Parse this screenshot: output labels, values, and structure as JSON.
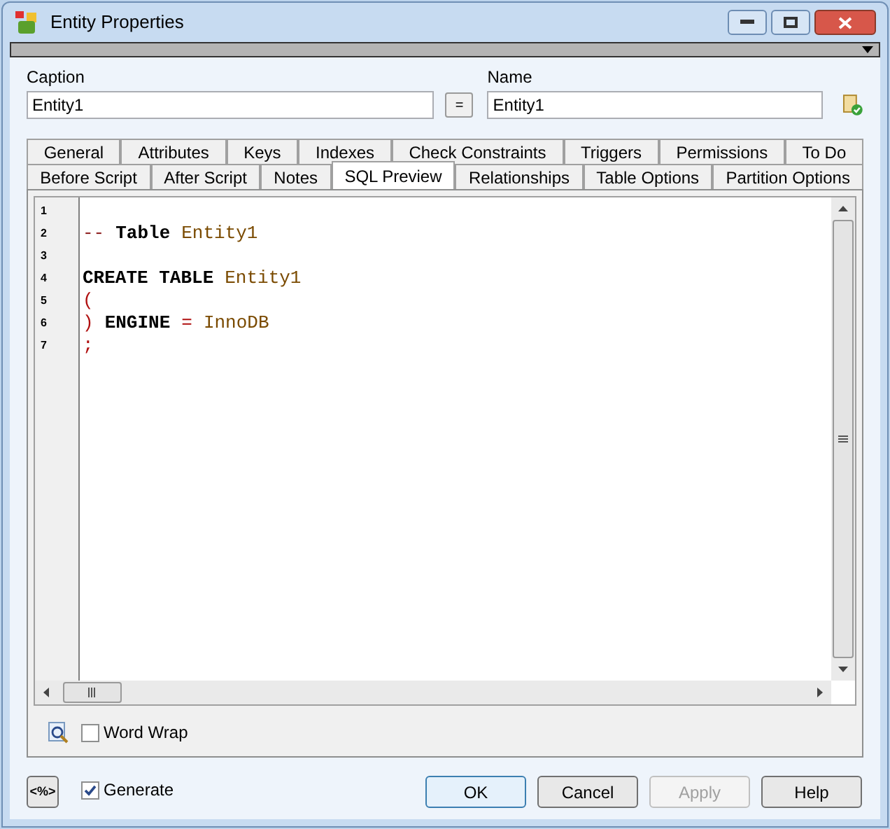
{
  "window": {
    "title": "Entity Properties"
  },
  "caption": {
    "label": "Caption",
    "value": "Entity1"
  },
  "copy_button": "=",
  "name": {
    "label": "Name",
    "value": "Entity1"
  },
  "tab_rows": [
    [
      {
        "label": "General",
        "selected": false
      },
      {
        "label": "Attributes",
        "selected": false
      },
      {
        "label": "Keys",
        "selected": false
      },
      {
        "label": "Indexes",
        "selected": false
      },
      {
        "label": "Check Constraints",
        "selected": false
      },
      {
        "label": "Triggers",
        "selected": false
      },
      {
        "label": "Permissions",
        "selected": false
      },
      {
        "label": "To Do",
        "selected": false
      }
    ],
    [
      {
        "label": "Before Script",
        "selected": false
      },
      {
        "label": "After Script",
        "selected": false
      },
      {
        "label": "Notes",
        "selected": false
      },
      {
        "label": "SQL Preview",
        "selected": true
      },
      {
        "label": "Relationships",
        "selected": false
      },
      {
        "label": "Table Options",
        "selected": false
      },
      {
        "label": "Partition Options",
        "selected": false
      }
    ]
  ],
  "editor": {
    "lines": [
      {
        "number": "1"
      },
      {
        "number": "2",
        "tokens": [
          {
            "kind": "comment",
            "text": "--"
          },
          {
            "kind": "keyword",
            "text": "Table"
          },
          {
            "kind": "ident",
            "text": "Entity1"
          }
        ]
      },
      {
        "number": "3"
      },
      {
        "number": "4",
        "tokens": [
          {
            "kind": "keyword",
            "text": "CREATE TABLE"
          },
          {
            "kind": "ident",
            "text": "Entity1"
          }
        ]
      },
      {
        "number": "5",
        "tokens": [
          {
            "kind": "symbol",
            "text": "("
          }
        ]
      },
      {
        "number": "6",
        "tokens": [
          {
            "kind": "symbol",
            "text": ")"
          },
          {
            "kind": "keyword",
            "text": "ENGINE"
          },
          {
            "kind": "symbol",
            "text": "="
          },
          {
            "kind": "ident",
            "text": "InnoDB"
          }
        ]
      },
      {
        "number": "7",
        "tokens": [
          {
            "kind": "symbol",
            "text": ";"
          }
        ]
      }
    ]
  },
  "word_wrap": {
    "label": "Word Wrap",
    "checked": false
  },
  "template_button": "<%>",
  "generate": {
    "label": "Generate",
    "checked": true
  },
  "buttons": [
    {
      "label": "OK",
      "default": true,
      "disabled": false
    },
    {
      "label": "Cancel",
      "default": false,
      "disabled": false
    },
    {
      "label": "Apply",
      "default": false,
      "disabled": true
    },
    {
      "label": "Help",
      "default": false,
      "disabled": false
    }
  ]
}
